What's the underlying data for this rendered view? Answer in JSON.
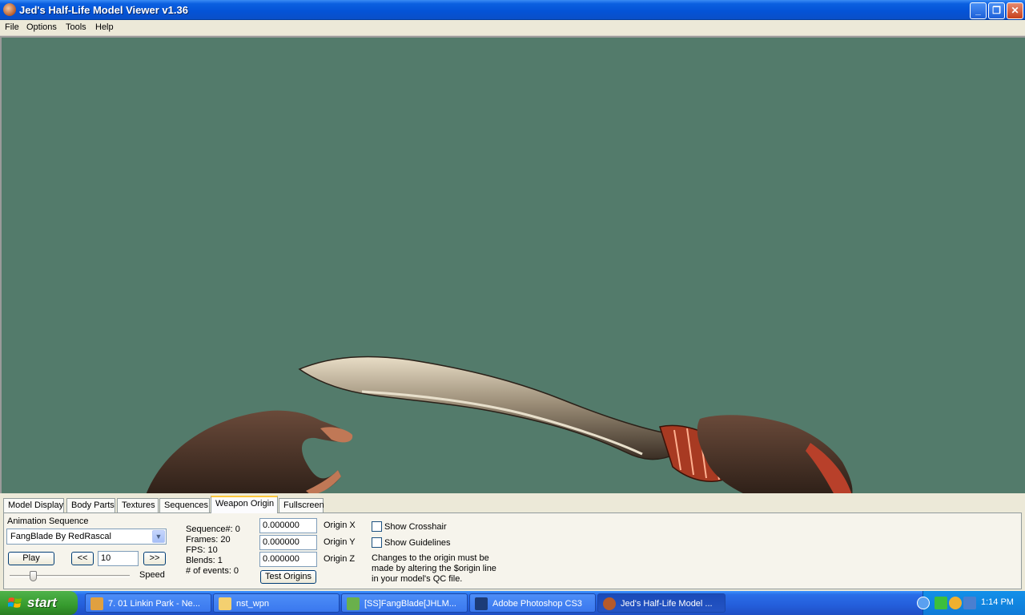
{
  "window": {
    "title": "Jed's Half-Life Model Viewer v1.36",
    "controls": {
      "minimize": "_",
      "maximize": "❐",
      "close": "✕"
    }
  },
  "menu": [
    "File",
    "Options",
    "Tools",
    "Help"
  ],
  "viewport": {
    "background_color": "#537b6b"
  },
  "tabs": [
    "Model Display",
    "Body Parts",
    "Textures",
    "Sequences",
    "Weapon Origin",
    "Fullscreen"
  ],
  "active_tab": "Weapon Origin",
  "animation": {
    "label": "Animation Sequence",
    "selected": "FangBlade By RedRascal",
    "play_label": "Play",
    "prev_label": "<<",
    "next_label": ">>",
    "frame_value": "10",
    "speed_label": "Speed",
    "speed_fraction": 0.2
  },
  "info": {
    "sequence": "Sequence#: 0",
    "frames": "Frames: 20",
    "fps": "FPS: 10",
    "blends": "Blends: 1",
    "events": "# of events: 0"
  },
  "origin": {
    "x_value": "0.000000",
    "y_value": "0.000000",
    "z_value": "0.000000",
    "x_label": "Origin X",
    "y_label": "Origin Y",
    "z_label": "Origin Z",
    "test_label": "Test Origins"
  },
  "options": {
    "crosshair_label": "Show Crosshair",
    "guidelines_label": "Show Guidelines",
    "note_line1": "Changes to the origin must be",
    "note_line2": "made by altering the $origin line",
    "note_line3": "in your model's QC file."
  },
  "taskbar": {
    "start_label": "start",
    "tasks": [
      {
        "label": "7. 01 Linkin Park - Ne...",
        "icon": "winamp-icon",
        "color": "#e0a040"
      },
      {
        "label": "nst_wpn",
        "icon": "folder-icon",
        "color": "#f4d070"
      },
      {
        "label": "[SS]FangBlade[JHLM...",
        "icon": "image-icon",
        "color": "#6ab04c"
      },
      {
        "label": "Adobe Photoshop CS3",
        "icon": "photoshop-icon",
        "color": "#1c3c78"
      },
      {
        "label": "Jed's Half-Life Model ...",
        "icon": "hlmv-icon",
        "color": "#b55a2a"
      }
    ],
    "clock": "1:14 PM"
  }
}
